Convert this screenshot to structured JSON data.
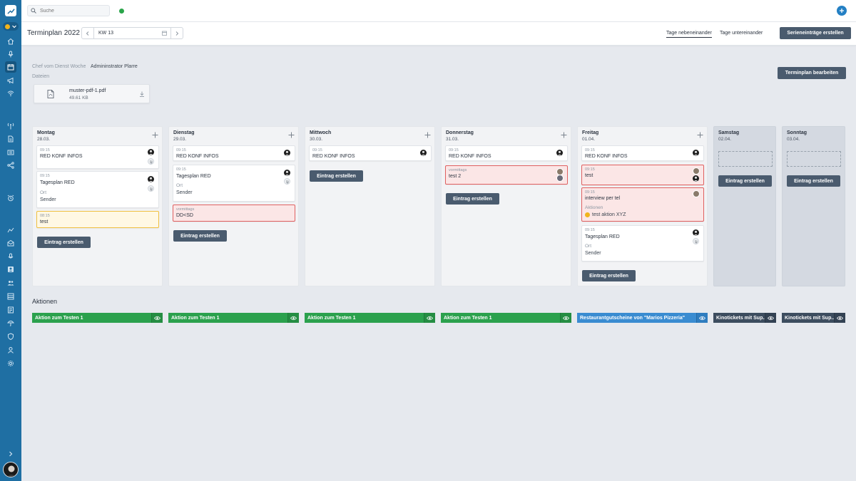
{
  "search": {
    "placeholder": "Suche"
  },
  "header": {
    "title": "Terminplan 2022",
    "week": "KW 13",
    "view_side_by_side": "Tage nebeneinander",
    "view_stacked": "Tage untereinander",
    "serien_button": "Serieneinträge erstellen"
  },
  "info": {
    "chef_label": "Chef vom Dienst Woche",
    "chef_value": "Admininstrator Plarre",
    "files_label": "Dateien",
    "file_name": "muster-pdf-1.pdf",
    "file_size": "49.61 KB",
    "edit_button": "Terminplan bearbeiten"
  },
  "days": [
    {
      "name": "Montag",
      "date": "28.03.",
      "create": "Eintrag erstellen",
      "entries": [
        {
          "time": "09:15",
          "title": "RED KONF INFOS"
        },
        {
          "time": "09:15",
          "title": "Tagesplan RED",
          "ort_label": "Ort",
          "ort_value": "Sender"
        },
        {
          "time": "08:15",
          "title": "test"
        }
      ]
    },
    {
      "name": "Dienstag",
      "date": "29.03.",
      "create": "Eintrag erstellen",
      "entries": [
        {
          "time": "09:15",
          "title": "RED KONF INFOS"
        },
        {
          "time": "09:15",
          "title": "Tagesplan RED",
          "ort_label": "Ort",
          "ort_value": "Sender"
        },
        {
          "time": "vormittags",
          "title": "DD<SD"
        }
      ]
    },
    {
      "name": "Mittwoch",
      "date": "30.03.",
      "create": "Eintrag erstellen",
      "entries": [
        {
          "time": "09:15",
          "title": "RED KONF INFOS"
        }
      ]
    },
    {
      "name": "Donnerstag",
      "date": "31.03.",
      "create": "Eintrag erstellen",
      "entries": [
        {
          "time": "09:15",
          "title": "RED KONF INFOS"
        },
        {
          "time": "vormittags",
          "title": "test 2"
        }
      ]
    },
    {
      "name": "Freitag",
      "date": "01.04.",
      "create": "Eintrag erstellen",
      "entries": [
        {
          "time": "09:15",
          "title": "RED KONF INFOS"
        },
        {
          "time": "09:15",
          "title": "test"
        },
        {
          "time": "09:15",
          "title": "interview per tel",
          "actions_label": "Aktionen",
          "action_value": "test aktion XYZ"
        },
        {
          "time": "09:15",
          "title": "Tagesplan RED",
          "ort_label": "Ort",
          "ort_value": "Sender"
        }
      ]
    },
    {
      "name": "Samstag",
      "date": "02.04.",
      "create": "Eintrag erstellen"
    },
    {
      "name": "Sonntag",
      "date": "03.04.",
      "create": "Eintrag erstellen"
    }
  ],
  "actions": {
    "title": "Aktionen",
    "items": [
      {
        "label": "Aktion zum Testen 1",
        "color": "#2ba14d"
      },
      {
        "label": "Aktion zum Testen 1",
        "color": "#2ba14d"
      },
      {
        "label": "Aktion zum Testen 1",
        "color": "#2ba14d"
      },
      {
        "label": "Aktion zum Testen 1",
        "color": "#2ba14d"
      },
      {
        "label": "Restaurantgutscheine von \"Marios Pizzeria\"",
        "color": "#3a8cd1"
      },
      {
        "label": "Kinotickets mit Sup...",
        "color": "#3d4d5f"
      },
      {
        "label": "Kinotickets mit Sup...",
        "color": "#3d4d5f"
      }
    ]
  },
  "colors": {
    "sidebar": "#1f6fa3",
    "primary_button": "#4a5b6e",
    "entry_warning": "#f0c040",
    "entry_alert": "#e06060",
    "online": "#2aa54a"
  }
}
